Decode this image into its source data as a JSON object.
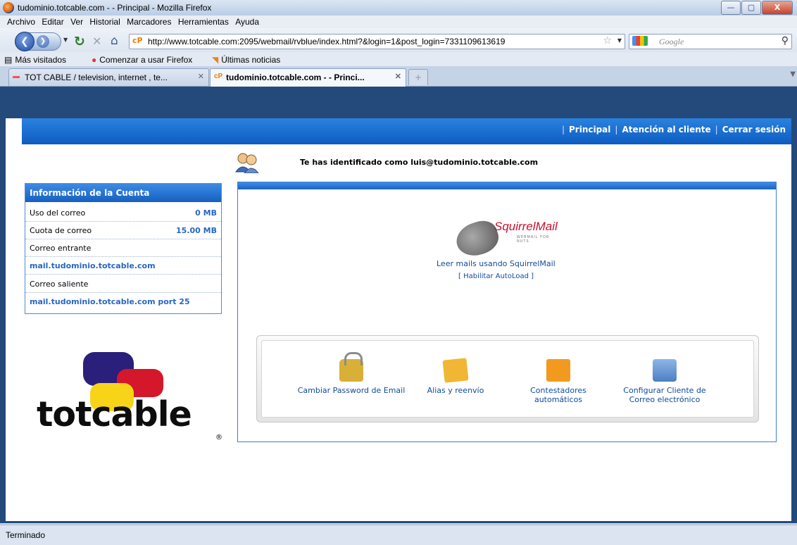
{
  "window": {
    "title": "tudominio.totcable.com - - Principal - Mozilla Firefox",
    "minimize": "—",
    "maximize": "▢",
    "close": "X"
  },
  "menu": [
    "Archivo",
    "Editar",
    "Ver",
    "Historial",
    "Marcadores",
    "Herramientas",
    "Ayuda"
  ],
  "nav": {
    "url": "http://www.totcable.com:2095/webmail/rvblue/index.html?&login=1&post_login=7331109613619",
    "search_placeholder": "Google",
    "cp_badge": "cP"
  },
  "bookmarks": [
    "Más visitados",
    "Comenzar a usar Firefox",
    "Últimas noticias"
  ],
  "tabs": [
    {
      "label": "TOT CABLE / television, internet , te...",
      "active": false
    },
    {
      "label": "tudominio.totcable.com - - Princi...",
      "active": true
    }
  ],
  "header_nav": [
    "Principal",
    "Atención al cliente",
    "Cerrar sesión"
  ],
  "identified": "Te has identificado como luis@tudominio.totcable.com",
  "account": {
    "title": "Información de la Cuenta",
    "rows": [
      {
        "label": "Uso del correo",
        "value": "0 MB"
      },
      {
        "label": "Cuota de correo",
        "value": "15.00 MB"
      },
      {
        "label": "Correo entrante",
        "value": ""
      },
      {
        "label": "mail.tudominio.totcable.com",
        "value": ""
      },
      {
        "label": "Correo saliente",
        "value": ""
      },
      {
        "label": "mail.tudominio.totcable.com port 25",
        "value": ""
      }
    ]
  },
  "logo": {
    "wordmark": "totcable",
    "reg": "®"
  },
  "squirrel": {
    "brand": "SquirrelMail",
    "tagline": "WEBMAIL FOR NUTS",
    "read_label": "Leer mails usando SquirrelMail",
    "autoload": "[ Habilitar AutoLoad ]"
  },
  "tools": [
    {
      "label": "Cambiar Password de Email",
      "icon": "lock-icon"
    },
    {
      "label": "Alias y reenvío",
      "icon": "forward-mail-icon"
    },
    {
      "label": "Contestadores automáticos",
      "icon": "autoresponder-icon"
    },
    {
      "label": "Configurar Cliente de Correo electrónico",
      "icon": "configure-client-icon"
    }
  ],
  "status": "Terminado"
}
